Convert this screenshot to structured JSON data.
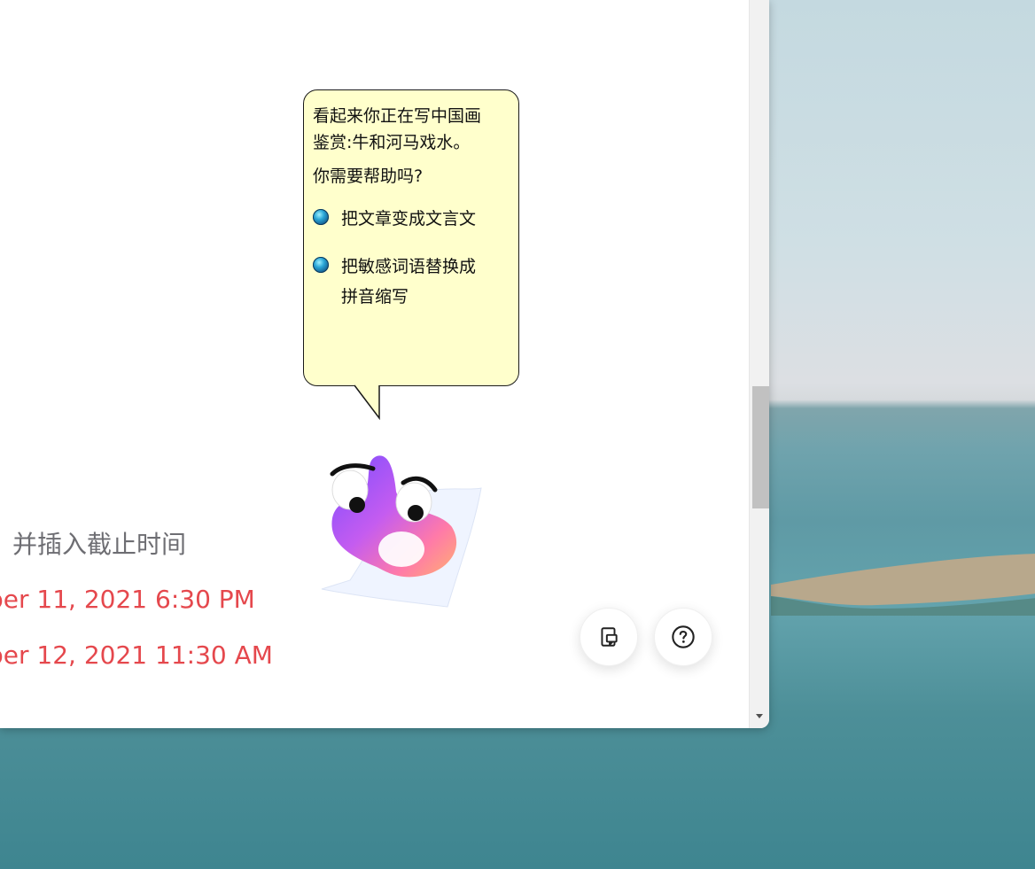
{
  "document": {
    "line_gray": "，并插入截止时间",
    "line_red_1": "ber 11, 2021 6:30 PM",
    "line_red_2": "ber 12, 2021 11:30 AM"
  },
  "assistant": {
    "message_line_1": "看起来你正在写中国画",
    "message_line_2": "鉴赏:牛和河马戏水。",
    "question": "你需要帮助吗?",
    "options": [
      {
        "label_line_1": "把文章变成文言文",
        "label_line_2": ""
      },
      {
        "label_line_1": "把敏感词语替换成",
        "label_line_2": "拼音缩写"
      }
    ]
  },
  "floating_buttons": {
    "notes_icon": "note-icon",
    "help_icon": "help-circle-icon"
  },
  "colors": {
    "accent_red": "#e5484d",
    "bubble_bg": "#ffffcc",
    "muted_text": "#6e6e73"
  }
}
